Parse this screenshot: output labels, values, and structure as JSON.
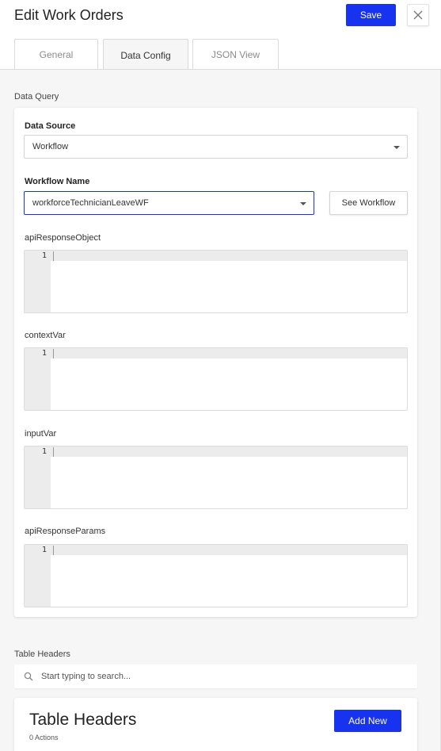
{
  "header": {
    "title": "Edit Work Orders",
    "save_label": "Save",
    "close_icon": "close-icon"
  },
  "tabs": [
    {
      "label": "General",
      "active": false
    },
    {
      "label": "Data Config",
      "active": true
    },
    {
      "label": "JSON View",
      "active": false
    }
  ],
  "data_query": {
    "section_label": "Data Query",
    "data_source": {
      "label": "Data Source",
      "value": "Workflow"
    },
    "workflow_name": {
      "label": "Workflow Name",
      "value": "workforceTechnicianLeaveWF",
      "see_button_label": "See Workflow"
    },
    "editors": [
      {
        "label": "apiResponseObject",
        "line_number": "1",
        "content": ""
      },
      {
        "label": "contextVar",
        "line_number": "1",
        "content": ""
      },
      {
        "label": "inputVar",
        "line_number": "1",
        "content": ""
      },
      {
        "label": "apiResponseParams",
        "line_number": "1",
        "content": ""
      }
    ]
  },
  "table_headers": {
    "section_label": "Table Headers",
    "search_placeholder": "Start typing to search...",
    "search_icon": "search-icon",
    "card_title": "Table Headers",
    "actions_count": "0 Actions",
    "add_new_label": "Add New"
  },
  "colors": {
    "accent": "#1833f0",
    "content_background": "#f6f6f6",
    "border": "#dadada"
  }
}
